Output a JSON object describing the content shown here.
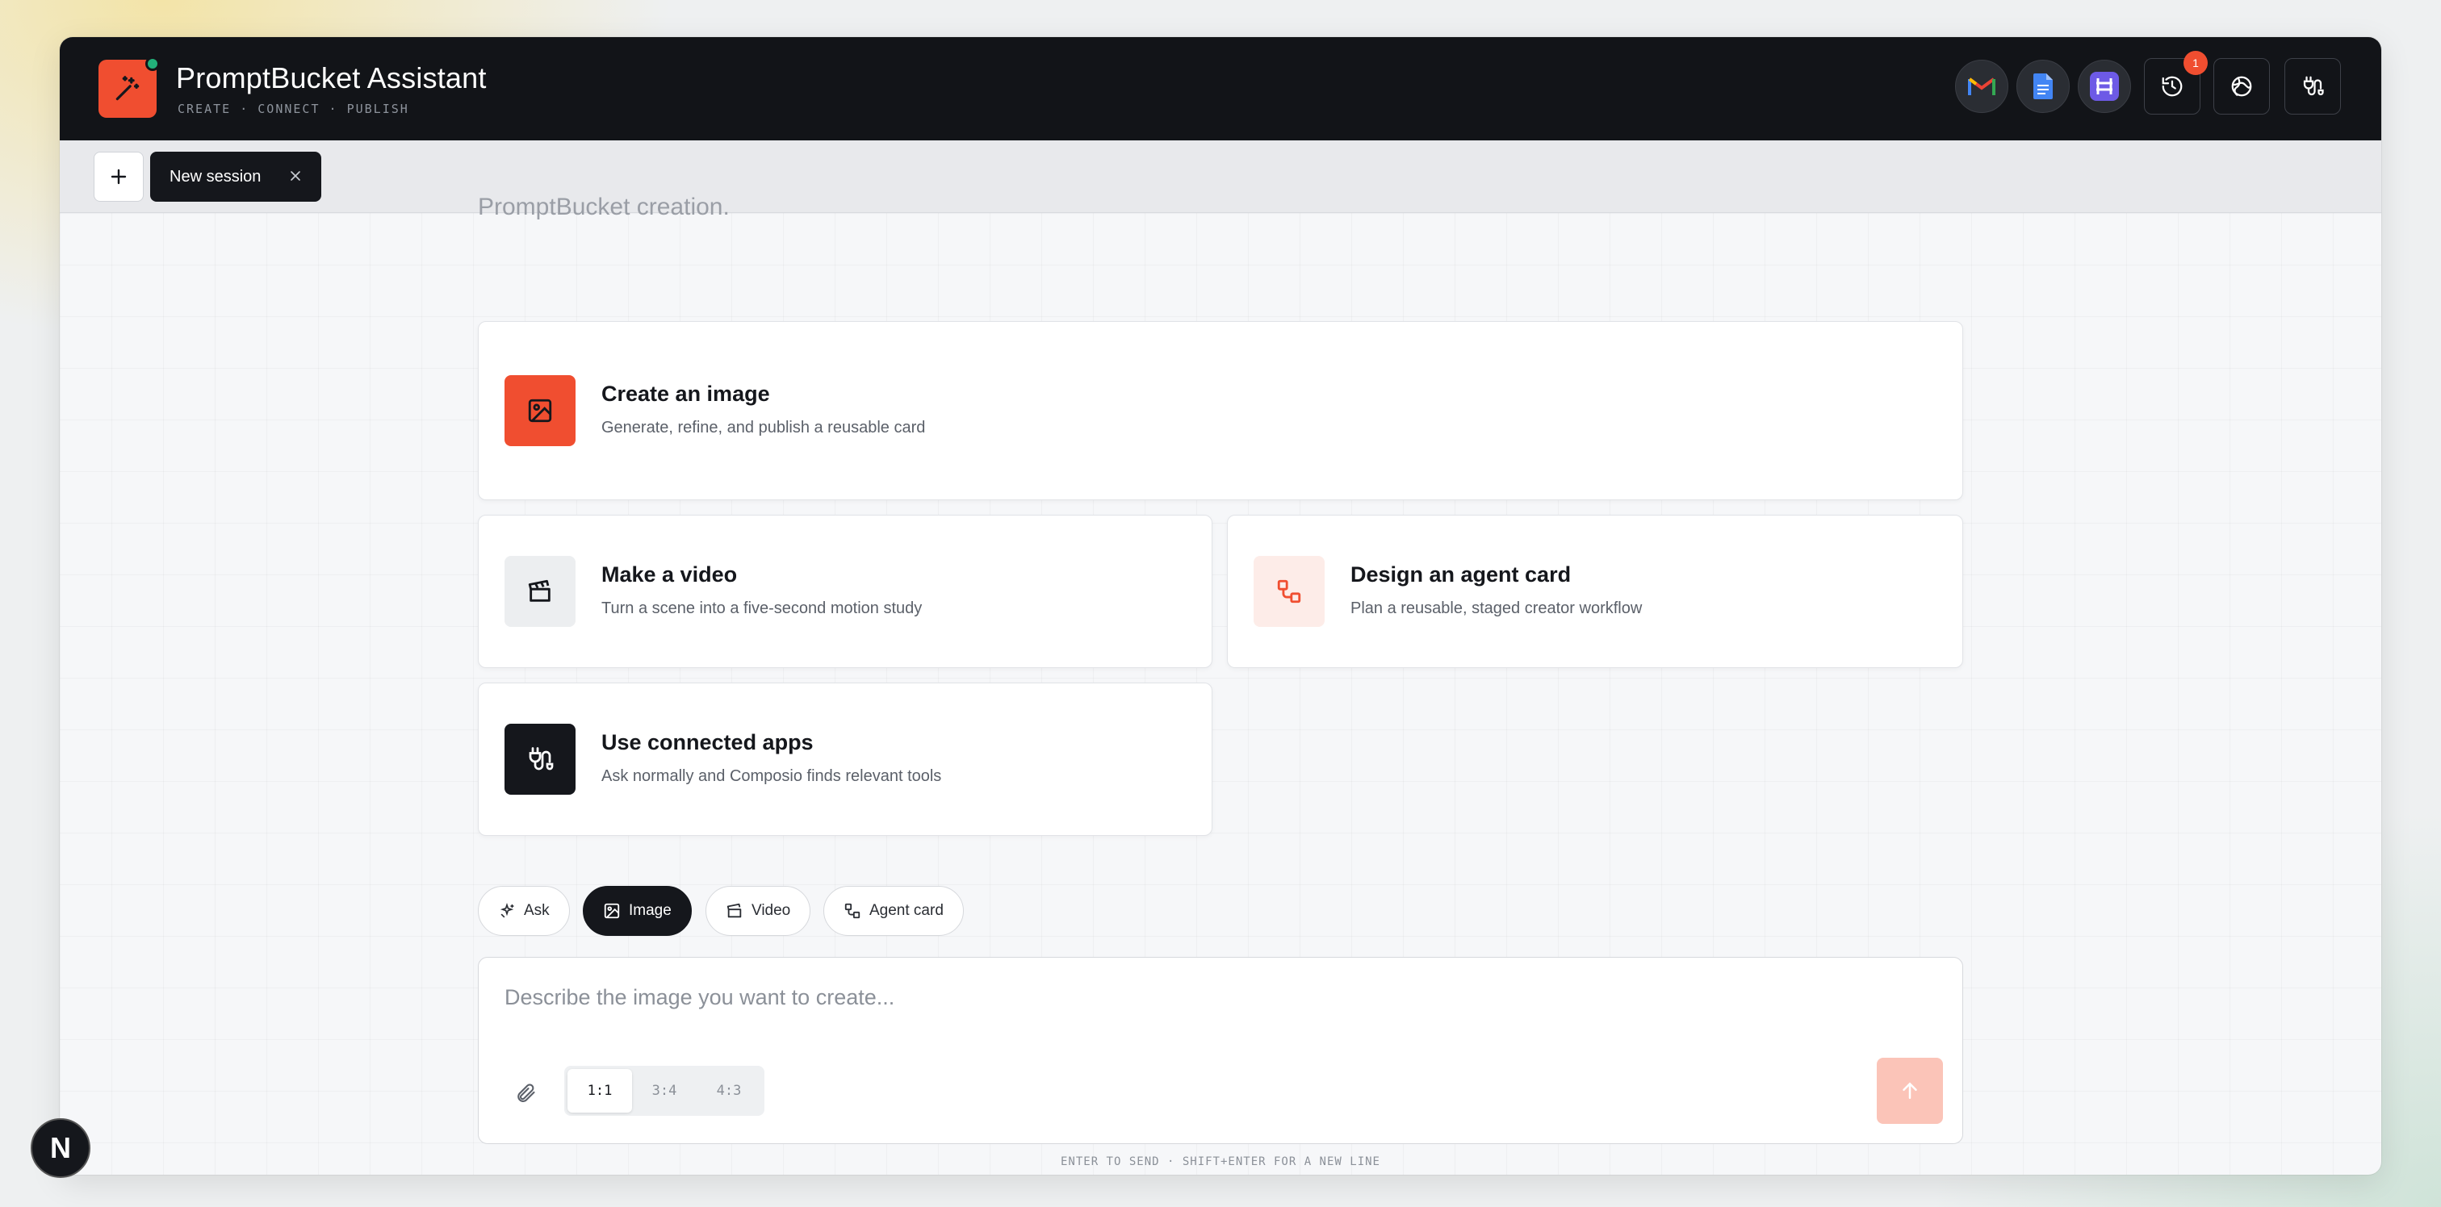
{
  "app": {
    "title": "PromptBucket Assistant",
    "subtitle": "CREATE · CONNECT · PUBLISH",
    "accent": "#f04e30",
    "status_color": "#22b07a"
  },
  "header": {
    "integrations": [
      {
        "name": "gmail-icon"
      },
      {
        "name": "google-docs-icon"
      },
      {
        "name": "integration-app-icon"
      }
    ],
    "actions": [
      {
        "name": "history-icon",
        "badge": "1"
      },
      {
        "name": "globe-icon"
      },
      {
        "name": "connections-icon"
      }
    ]
  },
  "tabs": {
    "add_label": "+",
    "session_label": "New session"
  },
  "main": {
    "faded_text": "PromptBucket creation."
  },
  "cards": [
    {
      "title": "Create an image",
      "desc": "Generate, refine, and publish a reusable card",
      "icon": "image-icon"
    },
    {
      "title": "Make a video",
      "desc": "Turn a scene into a five-second motion study",
      "icon": "clapperboard-icon"
    },
    {
      "title": "Design an agent card",
      "desc": "Plan a reusable, staged creator workflow",
      "icon": "workflow-icon"
    },
    {
      "title": "Use connected apps",
      "desc": "Ask normally and Composio finds relevant tools",
      "icon": "plug-icon"
    }
  ],
  "modes": [
    {
      "label": "Ask",
      "icon": "sparkles-icon",
      "active": false
    },
    {
      "label": "Image",
      "icon": "image-icon",
      "active": true
    },
    {
      "label": "Video",
      "icon": "clapperboard-icon",
      "active": false
    },
    {
      "label": "Agent card",
      "icon": "workflow-icon",
      "active": false
    }
  ],
  "composer": {
    "placeholder": "Describe the image you want to create...",
    "value": "",
    "ratios": [
      "1:1",
      "3:4",
      "4:3"
    ],
    "selected_ratio": "1:1"
  },
  "hint": "ENTER TO SEND · SHIFT+ENTER FOR A NEW LINE",
  "corner_badge": "N"
}
